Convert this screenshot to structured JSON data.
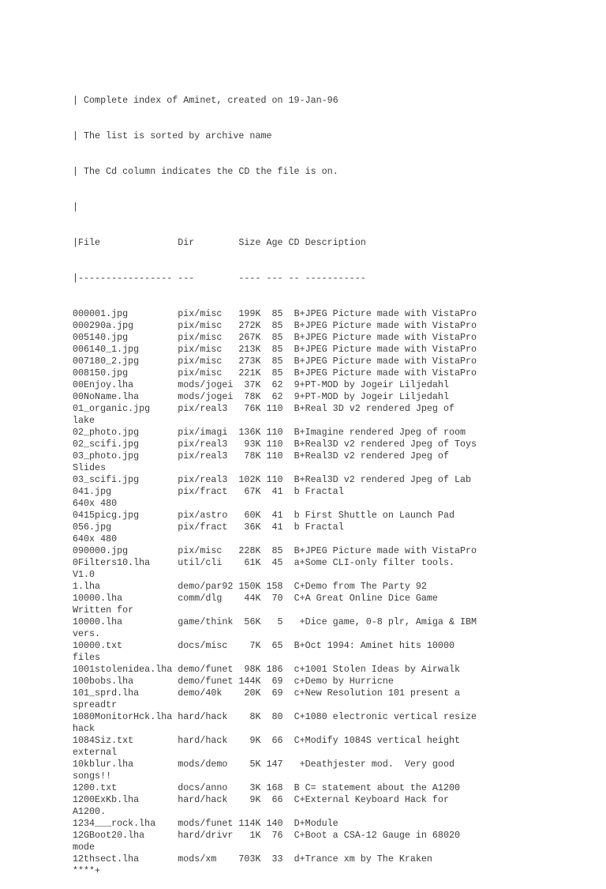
{
  "header": {
    "lines": [
      "| Complete index of Aminet, created on 19-Jan-96",
      "| The list is sorted by archive name",
      "| The Cd column indicates the CD the file is on.",
      "|"
    ]
  },
  "table": {
    "columns": [
      "File",
      "Dir",
      "Size",
      "Age",
      "CD",
      "Description"
    ],
    "header_line": "|File              Dir        Size Age CD Description",
    "separator_line": "|----------------- ---        ---- --- -- -----------",
    "rows": [
      {
        "file": "000001.jpg",
        "dir": "pix/misc",
        "size": "199K",
        "age": "85",
        "cd": "B+",
        "description": "JPEG Picture made with VistaPro",
        "wrap": ""
      },
      {
        "file": "000290a.jpg",
        "dir": "pix/misc",
        "size": "272K",
        "age": "85",
        "cd": "B+",
        "description": "JPEG Picture made with VistaPro",
        "wrap": ""
      },
      {
        "file": "005140.jpg",
        "dir": "pix/misc",
        "size": "267K",
        "age": "85",
        "cd": "B+",
        "description": "JPEG Picture made with VistaPro",
        "wrap": ""
      },
      {
        "file": "006140_1.jpg",
        "dir": "pix/misc",
        "size": "213K",
        "age": "85",
        "cd": "B+",
        "description": "JPEG Picture made with VistaPro",
        "wrap": ""
      },
      {
        "file": "007180_2.jpg",
        "dir": "pix/misc",
        "size": "273K",
        "age": "85",
        "cd": "B+",
        "description": "JPEG Picture made with VistaPro",
        "wrap": ""
      },
      {
        "file": "008150.jpg",
        "dir": "pix/misc",
        "size": "221K",
        "age": "85",
        "cd": "B+",
        "description": "JPEG Picture made with VistaPro",
        "wrap": ""
      },
      {
        "file": "00Enjoy.lha",
        "dir": "mods/jogei",
        "size": "37K",
        "age": "62",
        "cd": "9+",
        "description": "PT-MOD by Jogeir Liljedahl",
        "wrap": ""
      },
      {
        "file": "00NoName.lha",
        "dir": "mods/jogei",
        "size": "78K",
        "age": "62",
        "cd": "9+",
        "description": "PT-MOD by Jogeir Liljedahl",
        "wrap": ""
      },
      {
        "file": "01_organic.jpg",
        "dir": "pix/real3",
        "size": "76K",
        "age": "110",
        "cd": "B+",
        "description": "Real 3D v2 rendered Jpeg of",
        "wrap": "lake"
      },
      {
        "file": "02_photo.jpg",
        "dir": "pix/imagi",
        "size": "136K",
        "age": "110",
        "cd": "B+",
        "description": "Imagine rendered Jpeg of room",
        "wrap": ""
      },
      {
        "file": "02_scifi.jpg",
        "dir": "pix/real3",
        "size": "93K",
        "age": "110",
        "cd": "B+",
        "description": "Real3D v2 rendered Jpeg of Toys",
        "wrap": ""
      },
      {
        "file": "03_photo.jpg",
        "dir": "pix/real3",
        "size": "78K",
        "age": "110",
        "cd": "B+",
        "description": "Real3D v2 rendered Jpeg of",
        "wrap": "Slides"
      },
      {
        "file": "03_scifi.jpg",
        "dir": "pix/real3",
        "size": "102K",
        "age": "110",
        "cd": "B+",
        "description": "Real3D v2 rendered Jpeg of Lab",
        "wrap": ""
      },
      {
        "file": "041.jpg",
        "dir": "pix/fract",
        "size": "67K",
        "age": "41",
        "cd": "b ",
        "description": "Fractal",
        "wrap": "640x 480"
      },
      {
        "file": "0415picg.jpg",
        "dir": "pix/astro",
        "size": "60K",
        "age": "41",
        "cd": "b ",
        "description": "First Shuttle on Launch Pad",
        "wrap": ""
      },
      {
        "file": "056.jpg",
        "dir": "pix/fract",
        "size": "36K",
        "age": "41",
        "cd": "b ",
        "description": "Fractal",
        "wrap": "640x 480"
      },
      {
        "file": "090000.jpg",
        "dir": "pix/misc",
        "size": "228K",
        "age": "85",
        "cd": "B+",
        "description": "JPEG Picture made with VistaPro",
        "wrap": ""
      },
      {
        "file": "0Filters10.lha",
        "dir": "util/cli",
        "size": "61K",
        "age": "45",
        "cd": "a+",
        "description": "Some CLI-only filter tools.",
        "wrap": "V1.0"
      },
      {
        "file": "1.lha",
        "dir": "demo/par92",
        "size": "150K",
        "age": "158",
        "cd": "C+",
        "description": "Demo from The Party 92",
        "wrap": ""
      },
      {
        "file": "10000.lha",
        "dir": "comm/dlg",
        "size": "44K",
        "age": "70",
        "cd": "C+",
        "description": "A Great Online Dice Game",
        "wrap": "Written for"
      },
      {
        "file": "10000.lha",
        "dir": "game/think",
        "size": "56K",
        "age": "5",
        "cd": " +",
        "description": "Dice game, 0-8 plr, Amiga & IBM",
        "wrap": "vers."
      },
      {
        "file": "10000.txt",
        "dir": "docs/misc",
        "size": "7K",
        "age": "65",
        "cd": "B+",
        "description": "Oct 1994: Aminet hits 10000",
        "wrap": "files"
      },
      {
        "file": "1001stolenidea.lha",
        "dir": "demo/funet",
        "size": "98K",
        "age": "186",
        "cd": "c+",
        "description": "1001 Stolen Ideas by Airwalk",
        "wrap": ""
      },
      {
        "file": "100bobs.lha",
        "dir": "demo/funet",
        "size": "144K",
        "age": "69",
        "cd": "c+",
        "description": "Demo by Hurricne",
        "wrap": ""
      },
      {
        "file": "101_sprd.lha",
        "dir": "demo/40k",
        "size": "20K",
        "age": "69",
        "cd": "c+",
        "description": "New Resolution 101 present a",
        "wrap": "spreadtr"
      },
      {
        "file": "1080MonitorHck.lha",
        "dir": "hard/hack",
        "size": "8K",
        "age": "80",
        "cd": "C+",
        "description": "1080 electronic vertical resize",
        "wrap": "hack"
      },
      {
        "file": "1084Siz.txt",
        "dir": "hard/hack",
        "size": "9K",
        "age": "66",
        "cd": "C+",
        "description": "Modify 1084S vertical height",
        "wrap": "external"
      },
      {
        "file": "10kblur.lha",
        "dir": "mods/demo",
        "size": "5K",
        "age": "147",
        "cd": " +",
        "description": "Deathjester mod.  Very good",
        "wrap": "songs!!"
      },
      {
        "file": "1200.txt",
        "dir": "docs/anno",
        "size": "3K",
        "age": "168",
        "cd": "B ",
        "description": "C= statement about the A1200",
        "wrap": ""
      },
      {
        "file": "1200ExKb.lha",
        "dir": "hard/hack",
        "size": "9K",
        "age": "66",
        "cd": "C+",
        "description": "External Keyboard Hack for",
        "wrap": "A1200."
      },
      {
        "file": "1234___rock.lha",
        "dir": "mods/funet",
        "size": "114K",
        "age": "140",
        "cd": "D+",
        "description": "Module",
        "wrap": ""
      },
      {
        "file": "12GBoot20.lha",
        "dir": "hard/drivr",
        "size": "1K",
        "age": "76",
        "cd": "C+",
        "description": "Boot a CSA-12 Gauge in 68020",
        "wrap": "mode"
      },
      {
        "file": "12thsect.lha",
        "dir": "mods/xm",
        "size": "703K",
        "age": "33",
        "cd": "d+",
        "description": "Trance xm by The Kraken",
        "wrap": "****+"
      }
    ]
  }
}
